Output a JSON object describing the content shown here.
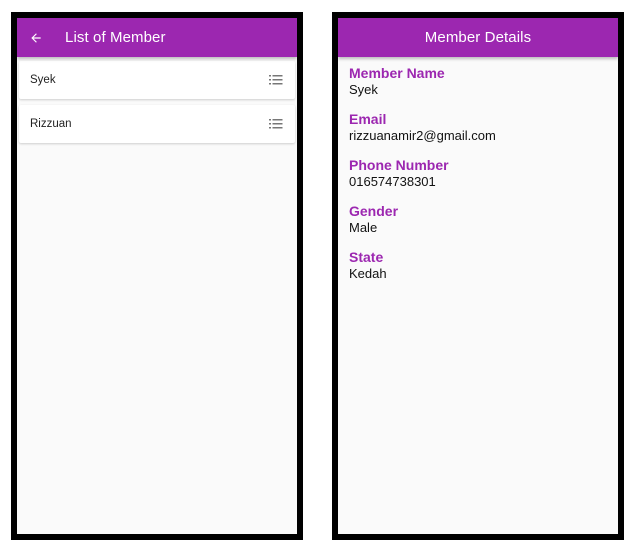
{
  "list_screen": {
    "title": "List of Member",
    "members": [
      {
        "name": "Syek"
      },
      {
        "name": "Rizzuan"
      }
    ]
  },
  "detail_screen": {
    "title": "Member Details",
    "fields": [
      {
        "label": "Member Name",
        "value": "Syek"
      },
      {
        "label": "Email",
        "value": "rizzuanamir2@gmail.com"
      },
      {
        "label": "Phone Number",
        "value": "016574738301"
      },
      {
        "label": "Gender",
        "value": "Male"
      },
      {
        "label": "State",
        "value": "Kedah"
      }
    ]
  },
  "icons": {
    "back": "arrow-back-icon",
    "list": "list-icon"
  },
  "colors": {
    "primary": "#9c27b0",
    "background": "#fafafa",
    "frame": "#000000"
  }
}
